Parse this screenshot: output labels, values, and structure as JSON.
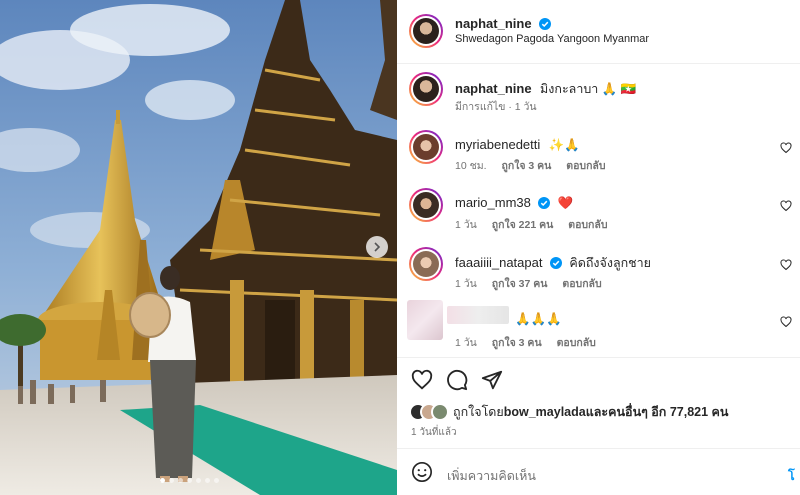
{
  "post": {
    "username": "naphat_nine",
    "location": "Shwedagon Pagoda Yangoon Myanmar"
  },
  "caption": {
    "username": "naphat_nine",
    "text": "มิงกะลาบา 🙏 🇲🇲",
    "edited": "มีการแก้ไข · 1 วัน"
  },
  "comments": [
    {
      "username": "myriabenedetti",
      "text": "✨🙏",
      "time": "10 ชม.",
      "likes": "ถูกใจ 3 คน",
      "reply": "ตอบกลับ"
    },
    {
      "username": "mario_mm38",
      "text": "❤️",
      "time": "1 วัน",
      "likes": "ถูกใจ 221 คน",
      "reply": "ตอบกลับ"
    },
    {
      "username": "faaaiiii_natapat",
      "text": "คิดถึงจังลูกชาย",
      "time": "1 วัน",
      "likes": "ถูกใจ 37 คน",
      "reply": "ตอบกลับ"
    },
    {
      "username": "",
      "text": "🙏🙏🙏",
      "time": "1 วัน",
      "likes": "ถูกใจ 3 คน",
      "reply": "ตอบกลับ"
    }
  ],
  "liked_by": {
    "prefix": "ถูกใจโดย ",
    "user": "bow_maylada",
    "suffix": " และคนอื่นๆ อีก 77,821 คน"
  },
  "posted_ago": "1 วันที่แล้ว",
  "add_comment": {
    "placeholder": "เพิ่มความคิดเห็น",
    "post_label": "โ"
  },
  "icons": {
    "like": "heart-icon",
    "comment": "comment-icon",
    "share": "share-icon",
    "emoji": "emoji-icon",
    "next": "chevron-right-icon"
  },
  "colors": {
    "verified": "#0095f6",
    "link": "#0095f6",
    "muted": "#737373"
  },
  "carousel": {
    "count": 7,
    "active": 1
  }
}
